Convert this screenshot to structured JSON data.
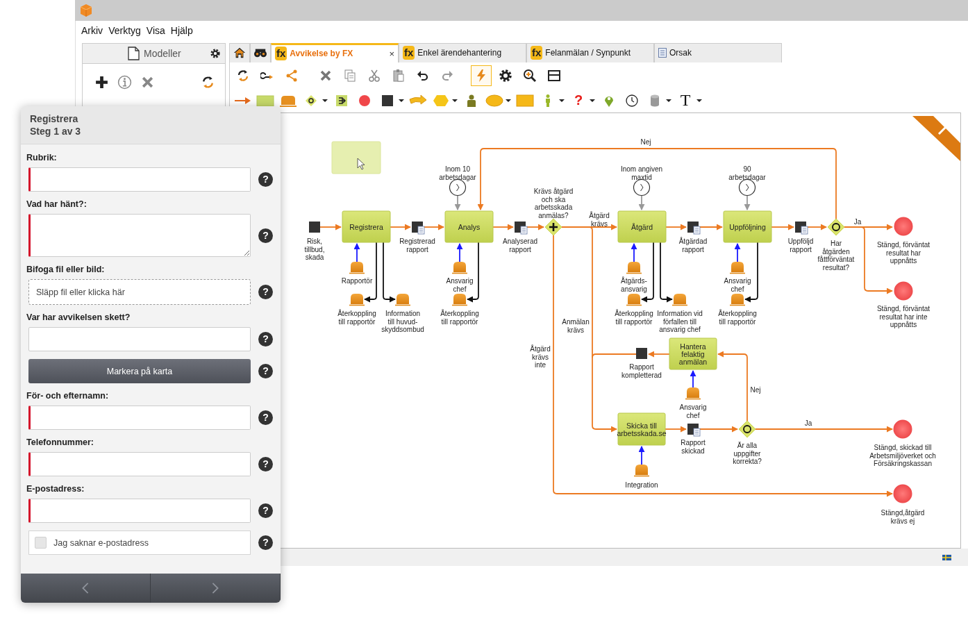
{
  "menu": [
    "Arkiv",
    "Verktyg",
    "Visa",
    "Hjälp"
  ],
  "models_panel": {
    "title": "Modeller"
  },
  "tabs": [
    {
      "kind": "home",
      "selected": false
    },
    {
      "kind": "binoculars",
      "selected": false
    },
    {
      "kind": "fx",
      "badge": "fx",
      "label": "Avvikelse by FX",
      "close": "×",
      "selected": true
    },
    {
      "kind": "fx",
      "badge": "fx",
      "label": "Enkel ärendehantering",
      "selected": false
    },
    {
      "kind": "fx",
      "badge": "fx",
      "label": "Felanmälan / Synpunkt",
      "selected": false
    },
    {
      "kind": "document",
      "label": "Orsak",
      "selected": false
    }
  ],
  "toolbar": [
    {
      "kind": "sync",
      "selected": false
    },
    {
      "kind": "connect",
      "selected": false
    },
    {
      "kind": "share",
      "selected": false
    },
    {
      "kind": "delete",
      "selected": false
    },
    {
      "kind": "copy",
      "selected": false
    },
    {
      "kind": "cut",
      "selected": false
    },
    {
      "kind": "paste",
      "selected": false
    },
    {
      "kind": "undo",
      "selected": false
    },
    {
      "kind": "redo",
      "selected": false
    },
    {
      "kind": "lightning",
      "selected": true
    },
    {
      "kind": "gear",
      "selected": false
    },
    {
      "kind": "zoom",
      "selected": false
    },
    {
      "kind": "panel",
      "selected": false
    }
  ],
  "palette": [
    {
      "kind": "flow",
      "dropdown": false
    },
    {
      "kind": "task",
      "dropdown": false
    },
    {
      "kind": "actor",
      "dropdown": false
    },
    {
      "kind": "gateway",
      "dropdown": true
    },
    {
      "kind": "lane",
      "dropdown": false
    },
    {
      "kind": "end",
      "dropdown": false
    },
    {
      "kind": "data",
      "dropdown": true
    },
    {
      "kind": "message",
      "dropdown": false
    },
    {
      "kind": "hexagon",
      "dropdown": true
    },
    {
      "kind": "person",
      "dropdown": false
    },
    {
      "kind": "ellipse",
      "dropdown": true
    },
    {
      "kind": "rect",
      "dropdown": false
    },
    {
      "kind": "figure",
      "dropdown": true
    },
    {
      "kind": "question",
      "label": "?",
      "dropdown": true
    },
    {
      "kind": "pin",
      "dropdown": false
    },
    {
      "kind": "clock",
      "dropdown": false
    },
    {
      "kind": "cylinder",
      "dropdown": true
    },
    {
      "kind": "text",
      "label": "T",
      "dropdown": true
    }
  ],
  "diagram": {
    "nodes": [
      {
        "kind": "note"
      },
      {
        "kind": "start",
        "label": "Risk,\ntillbud,\nskada"
      },
      {
        "kind": "task",
        "label": "Registrera"
      },
      {
        "kind": "data",
        "attached_document": true,
        "label": "Registrerad\nrapport"
      },
      {
        "kind": "timer",
        "label": "Inom 10\narbetsdagar"
      },
      {
        "kind": "task",
        "label": "Analys"
      },
      {
        "kind": "data",
        "attached_document": true,
        "label": "Analyserad\nrapport"
      },
      {
        "kind": "gateway-parallel",
        "label": "Krävs åtgärd\noch ska\narbetsskada\nanmälas?"
      },
      {
        "kind": "label",
        "label": "Åtgärd\nkrävs"
      },
      {
        "kind": "label",
        "label": "Nej"
      },
      {
        "kind": "timer",
        "label": "Inom angiven\nmaxtid"
      },
      {
        "kind": "task",
        "label": "Åtgärd"
      },
      {
        "kind": "data",
        "attached_document": true,
        "label": "Åtgärdad\nrapport"
      },
      {
        "kind": "timer",
        "label": "90\narbetsdagar"
      },
      {
        "kind": "task",
        "label": "Uppföljning"
      },
      {
        "kind": "data",
        "attached_document": true,
        "label": "Uppföljd\nrapport"
      },
      {
        "kind": "gateway-inclusive",
        "label": "Har\nåtgärden\nfåttförväntat\nresultat?"
      },
      {
        "kind": "label",
        "label": "Ja"
      },
      {
        "kind": "end",
        "label": "Stängd, förväntat\nresultat har\nuppnåtts"
      },
      {
        "kind": "end",
        "label": "Stängd, förväntat\nresultat har inte\nuppnåtts"
      },
      {
        "kind": "actor",
        "label": "Rapportör"
      },
      {
        "kind": "actor",
        "label": "Återkoppling\ntill rapportör"
      },
      {
        "kind": "actor",
        "label": "Information\ntill huvud-\nskyddsombud"
      },
      {
        "kind": "actor",
        "label": "Ansvarig\nchef"
      },
      {
        "kind": "actor",
        "label": "Återkoppling\ntill rapportör"
      },
      {
        "kind": "actor",
        "label": "Åtgärds-\nansvarig"
      },
      {
        "kind": "actor",
        "label": "Återkoppling\ntill rapportör"
      },
      {
        "kind": "actor",
        "label": "Information vid\nförfallen till\nansvarig chef"
      },
      {
        "kind": "actor",
        "label": "Ansvarig\nchef"
      },
      {
        "kind": "actor",
        "label": "Återkoppling\ntill rapportör"
      },
      {
        "kind": "label",
        "label": "Anmälan\nkrävs"
      },
      {
        "kind": "label",
        "label": "Åtgärd\nkrävs\ninte"
      },
      {
        "kind": "task",
        "label": "Hantera\nfelaktig\nanmälan"
      },
      {
        "kind": "data",
        "attached_document": false,
        "label": "Rapport\nkompletterad"
      },
      {
        "kind": "actor",
        "label": "Ansvarig\nchef"
      },
      {
        "kind": "task",
        "label": "Skicka till\narbetsskada.se"
      },
      {
        "kind": "data",
        "attached_document": true,
        "label": "Rapport\nskickad"
      },
      {
        "kind": "actor",
        "label": "Integration"
      },
      {
        "kind": "label",
        "label": "Nej"
      },
      {
        "kind": "gateway-inclusive",
        "label": "Är alla\nuppgifter\nkorrekta?"
      },
      {
        "kind": "label",
        "label": "Ja"
      },
      {
        "kind": "end",
        "label": "Stängd, skickad till\nArbetsmiljöverket och\nFörsäkringskassan"
      },
      {
        "kind": "end",
        "label": "Stängd,åtgärd\nkrävs ej"
      }
    ]
  },
  "form": {
    "title": "Registrera",
    "step": "Steg 1 av 3",
    "items": [
      {
        "kind": "text",
        "heading": "Rubrik:",
        "required": true,
        "help": "?"
      },
      {
        "kind": "textarea",
        "heading": "Vad har hänt?:",
        "required": true,
        "help": "?"
      },
      {
        "kind": "dropzone",
        "heading": "Bifoga fil eller bild:",
        "placeholder": "Släpp fil eller klicka här",
        "help": "?"
      },
      {
        "kind": "text",
        "heading": "Var har avvikelsen skett?",
        "required": false,
        "help": "?"
      },
      {
        "kind": "button",
        "label": "Markera på karta",
        "help": "?"
      },
      {
        "kind": "text",
        "heading": "För- och efternamn:",
        "required": true,
        "help": "?"
      },
      {
        "kind": "text",
        "heading": "Telefonnummer:",
        "required": true,
        "help": "?"
      },
      {
        "kind": "text",
        "heading": "E-postadress:",
        "required": true,
        "help": "?"
      },
      {
        "kind": "checkbox",
        "label": "Jag saknar e-postadress",
        "checked": false,
        "help": "?"
      }
    ]
  }
}
